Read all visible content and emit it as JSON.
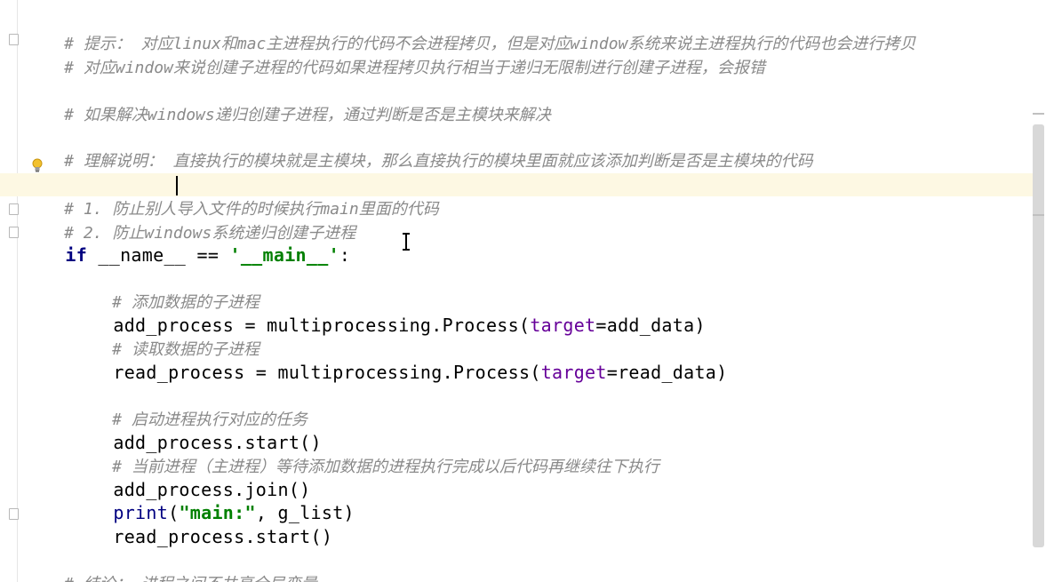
{
  "editor": {
    "lines": {
      "l1": "# 提示： 对应linux和mac主进程执行的代码不会进程拷贝，但是对应window系统来说主进程执行的代码也会进行拷贝",
      "l2": "# 对应window来说创建子进程的代码如果进程拷贝执行相当于递归无限制进行创建子进程，会报错",
      "l3": "# 如果解决windows递归创建子进程，通过判断是否是主模块来解决",
      "l4": "# 理解说明： 直接执行的模块就是主模块，那么直接执行的模块里面就应该添加判断是否是主模块的代码",
      "l5": "# 1. 防止别人导入文件的时候执行main里面的代码",
      "l6": "# 2. 防止windows系统递归创建子进程",
      "l7_kw": "if",
      "l7_mid": " __name__ == ",
      "l7_str": "'__main__'",
      "l7_end": ":",
      "l8": "# 添加数据的子进程",
      "l9_a": "add_process = multiprocessing.Process(",
      "l9_kwarg": "target",
      "l9_b": "=add_data)",
      "l10": "# 读取数据的子进程",
      "l11_a": "read_process = multiprocessing.Process(",
      "l11_kwarg": "target",
      "l11_b": "=read_data)",
      "l12": "# 启动进程执行对应的任务",
      "l13": "add_process.start()",
      "l14": "# 当前进程（主进程）等待添加数据的进程执行完成以后代码再继续往下执行",
      "l15": "add_process.join()",
      "l16_builtin": "print",
      "l16_a": "(",
      "l16_str": "\"main:\"",
      "l16_b": ", g_list)",
      "l17": "read_process.start()",
      "l18": "# 结论： 进程之间不共享全局变量"
    }
  },
  "icons": {
    "bulb": "lightbulb-icon",
    "fold": "fold-marker-icon",
    "cursor": "text-cursor-icon"
  },
  "colors": {
    "comment": "#8a8a8a",
    "keyword": "#000080",
    "string": "#008000",
    "kwarg": "#660099",
    "current_line": "#fdf8e3"
  }
}
